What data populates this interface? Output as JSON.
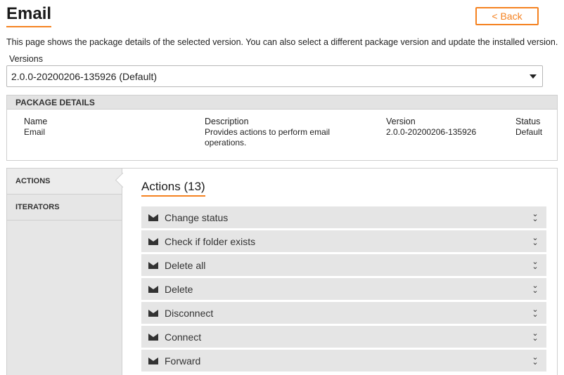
{
  "page": {
    "title": "Email",
    "back_label": "< Back",
    "intro": "This page shows the package details of the selected version. You can also select a different package version and update the installed version."
  },
  "versions": {
    "label": "Versions",
    "selected": "2.0.0-20200206-135926 (Default)"
  },
  "package_details": {
    "header": "PACKAGE DETAILS",
    "columns": {
      "name": {
        "heading": "Name",
        "value": "Email"
      },
      "description": {
        "heading": "Description",
        "value": "Provides actions to perform email operations."
      },
      "version": {
        "heading": "Version",
        "value": "2.0.0-20200206-135926"
      },
      "status": {
        "heading": "Status",
        "value": "Default"
      }
    }
  },
  "sidebar": {
    "items": [
      {
        "label": "ACTIONS",
        "active": true
      },
      {
        "label": "ITERATORS",
        "active": false
      }
    ]
  },
  "actions": {
    "title": "Actions (13)",
    "items": [
      {
        "label": "Change status",
        "icon": "envelope-icon"
      },
      {
        "label": "Check if folder exists",
        "icon": "envelope-icon"
      },
      {
        "label": "Delete all",
        "icon": "envelope-icon"
      },
      {
        "label": "Delete",
        "icon": "envelope-icon"
      },
      {
        "label": "Disconnect",
        "icon": "envelope-icon"
      },
      {
        "label": "Connect",
        "icon": "envelope-icon"
      },
      {
        "label": "Forward",
        "icon": "envelope-icon"
      }
    ]
  },
  "colors": {
    "accent": "#f58220",
    "row_bg": "#e5e5e5",
    "sidebar_bg": "#e6e6e6"
  }
}
